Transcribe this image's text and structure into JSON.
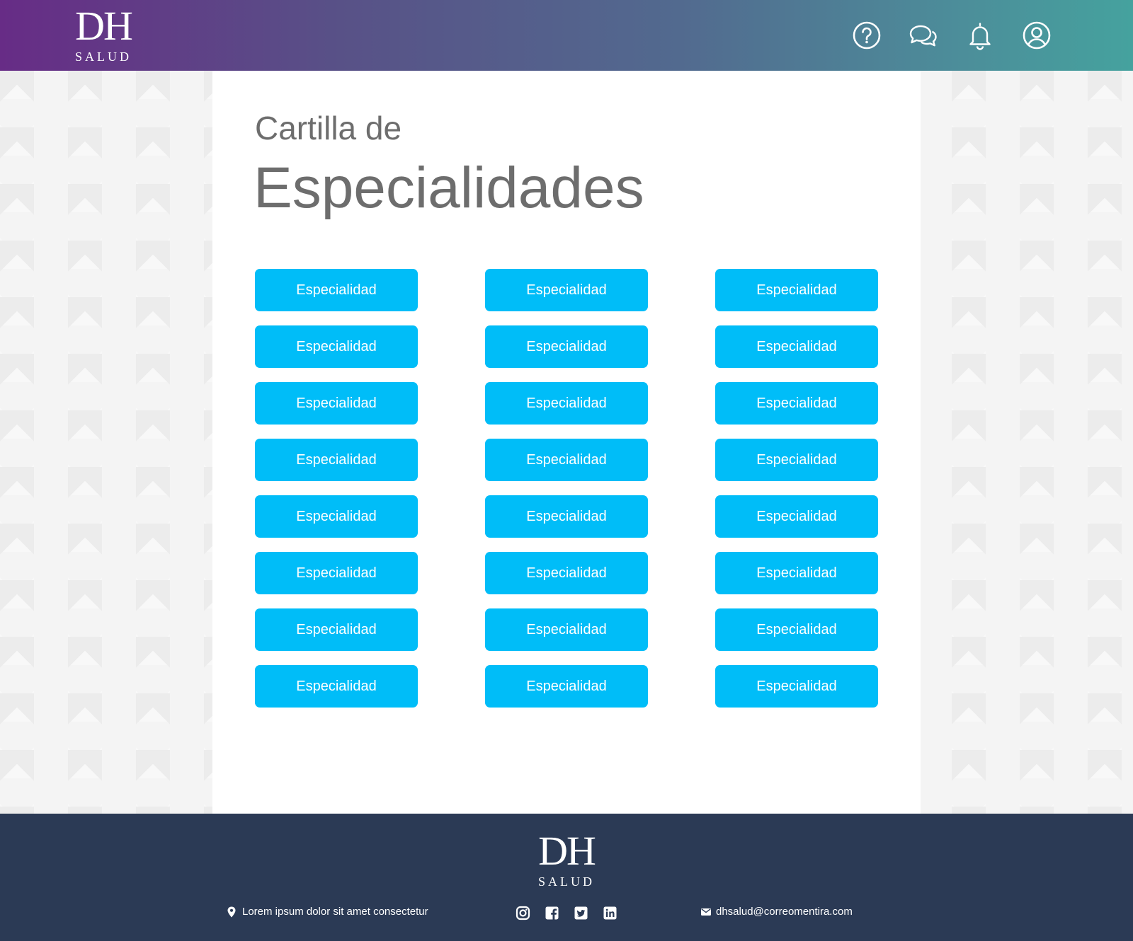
{
  "brand": {
    "mark": "DH",
    "sub": "SALUD"
  },
  "header": {
    "icons": [
      "help-icon",
      "chat-icon",
      "bell-icon",
      "user-icon"
    ]
  },
  "main": {
    "title_small": "Cartilla de",
    "title_big": "Especialidades",
    "buttons": [
      "Especialidad",
      "Especialidad",
      "Especialidad",
      "Especialidad",
      "Especialidad",
      "Especialidad",
      "Especialidad",
      "Especialidad",
      "Especialidad",
      "Especialidad",
      "Especialidad",
      "Especialidad",
      "Especialidad",
      "Especialidad",
      "Especialidad",
      "Especialidad",
      "Especialidad",
      "Especialidad",
      "Especialidad",
      "Especialidad",
      "Especialidad",
      "Especialidad",
      "Especialidad",
      "Especialidad"
    ]
  },
  "footer": {
    "address": "Lorem ipsum dolor sit amet consectetur",
    "email": "dhsalud@correomentira.com",
    "social": [
      "instagram-icon",
      "facebook-icon",
      "twitter-icon",
      "linkedin-icon"
    ]
  },
  "colors": {
    "header_gradient_start": "#672c86",
    "header_gradient_end": "#45a29e",
    "button": "#00bdf8",
    "footer": "#2b3a55",
    "title": "#6d6d6d"
  }
}
